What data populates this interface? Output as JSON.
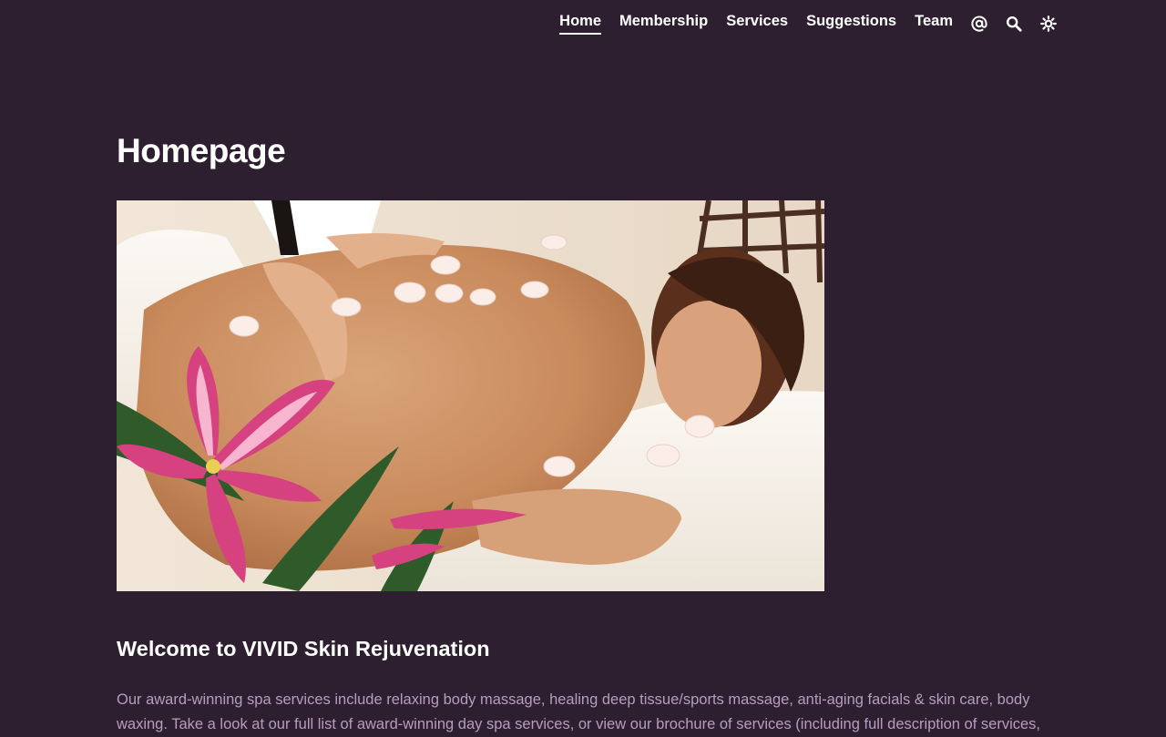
{
  "nav": {
    "items": [
      {
        "label": "Home",
        "active": true
      },
      {
        "label": "Membership",
        "active": false
      },
      {
        "label": "Services",
        "active": false
      },
      {
        "label": "Suggestions",
        "active": false
      },
      {
        "label": "Team",
        "active": false
      }
    ],
    "icons": [
      "at-icon",
      "search-icon",
      "theme-toggle-icon"
    ]
  },
  "main": {
    "title": "Homepage",
    "hero_image": {
      "name": "hero-image",
      "depicts": "woman receiving back massage with pink lilies and petals"
    },
    "welcome_heading": "Welcome to VIVID Skin Rejuvenation",
    "intro_text": "Our award-winning spa services include relaxing body massage, healing deep tissue/sports massage, anti-aging facials & skin care, body waxing. Take a look at our full list of award-winning day spa services, or view our brochure of services (including full description of services,"
  },
  "colors": {
    "background": "#2d1f30",
    "text": "#ffffff",
    "muted_text": "#b89cc0"
  }
}
